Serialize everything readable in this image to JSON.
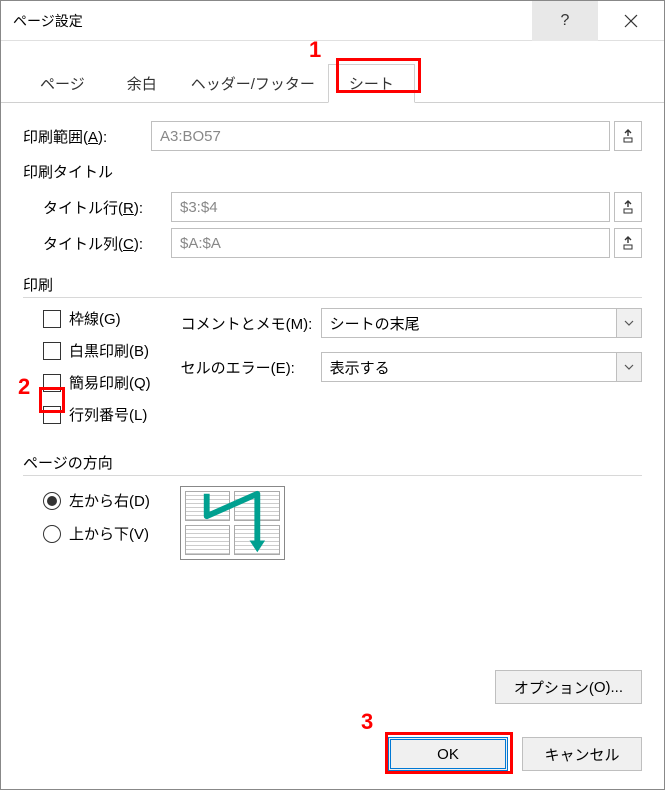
{
  "title": "ページ設定",
  "tabs": {
    "page": "ページ",
    "margins": "余白",
    "headerfooter": "ヘッダー/フッター",
    "sheet": "シート"
  },
  "printArea": {
    "label_pre": "印刷範囲(",
    "label_u": "A",
    "label_post": "):",
    "value": "A3:BO57"
  },
  "printTitles": {
    "groupLabel": "印刷タイトル",
    "rows_pre": "タイトル行(",
    "rows_u": "R",
    "rows_post": "):",
    "rows_value": "$3:$4",
    "cols_pre": "タイトル列(",
    "cols_u": "C",
    "cols_post": "):",
    "cols_value": "$A:$A"
  },
  "printGroup": {
    "label": "印刷",
    "gridlines_pre": "枠線(",
    "gridlines_u": "G",
    "gridlines_post": ")",
    "bw_pre": "白黒印刷(",
    "bw_u": "B",
    "bw_post": ")",
    "draft_pre": "簡易印刷(",
    "draft_u": "Q",
    "draft_post": ")",
    "rowcol_pre": "行列番号(",
    "rowcol_u": "L",
    "rowcol_post": ")",
    "comments_pre": "コメントとメモ(",
    "comments_u": "M",
    "comments_post": "):",
    "comments_value": "シートの末尾",
    "errors_pre": "セルのエラー(",
    "errors_u": "E",
    "errors_post": "):",
    "errors_value": "表示する"
  },
  "pageOrder": {
    "label": "ページの方向",
    "ltr_pre": "左から右(",
    "ltr_u": "D",
    "ltr_post": ")",
    "ttb_pre": "上から下(",
    "ttb_u": "V",
    "ttb_post": ")"
  },
  "buttons": {
    "options_pre": "オプション(",
    "options_u": "O",
    "options_post": ")...",
    "ok": "OK",
    "cancel": "キャンセル"
  },
  "callouts": {
    "c1": "1",
    "c2": "2",
    "c3": "3"
  }
}
